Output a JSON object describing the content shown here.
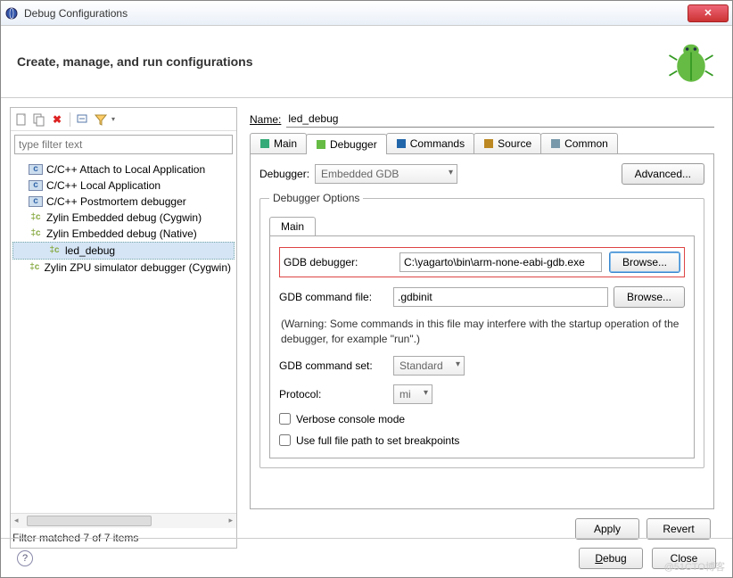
{
  "window": {
    "title": "Debug Configurations"
  },
  "header": {
    "title": "Create, manage, and run configurations"
  },
  "filter": {
    "placeholder": "type filter text"
  },
  "tree": {
    "items": [
      {
        "label": "C/C++ Attach to Local Application",
        "type": "c"
      },
      {
        "label": "C/C++ Local Application",
        "type": "c"
      },
      {
        "label": "C/C++ Postmortem debugger",
        "type": "c"
      },
      {
        "label": "Zylin Embedded debug (Cygwin)",
        "type": "z"
      },
      {
        "label": "Zylin Embedded debug (Native)",
        "type": "z"
      },
      {
        "label": "led_debug",
        "type": "z",
        "child": true,
        "selected": true
      },
      {
        "label": "Zylin ZPU simulator debugger (Cygwin)",
        "type": "z"
      }
    ]
  },
  "filter_status": "Filter matched 7 of 7 items",
  "form": {
    "name_label": "Name:",
    "name_value": "led_debug"
  },
  "tabs": {
    "items": [
      "Main",
      "Debugger",
      "Commands",
      "Source",
      "Common"
    ],
    "active": 1
  },
  "debugger": {
    "label": "Debugger:",
    "value": "Embedded GDB",
    "advanced": "Advanced...",
    "options_title": "Debugger Options",
    "inner_tab": "Main",
    "gdb_label": "GDB debugger:",
    "gdb_value": "C:\\yagarto\\bin\\arm-none-eabi-gdb.exe",
    "browse": "Browse...",
    "cmdfile_label": "GDB command file:",
    "cmdfile_value": ".gdbinit",
    "warning": "(Warning: Some commands in this file may interfere with the startup operation of the debugger, for example \"run\".)",
    "cmdset_label": "GDB command set:",
    "cmdset_value": "Standard",
    "protocol_label": "Protocol:",
    "protocol_value": "mi",
    "verbose": "Verbose console mode",
    "fullpath": "Use full file path to set breakpoints"
  },
  "buttons": {
    "apply": "Apply",
    "revert": "Revert",
    "debug": "Debug",
    "close": "Close"
  },
  "watermark": "@51CTO博客"
}
